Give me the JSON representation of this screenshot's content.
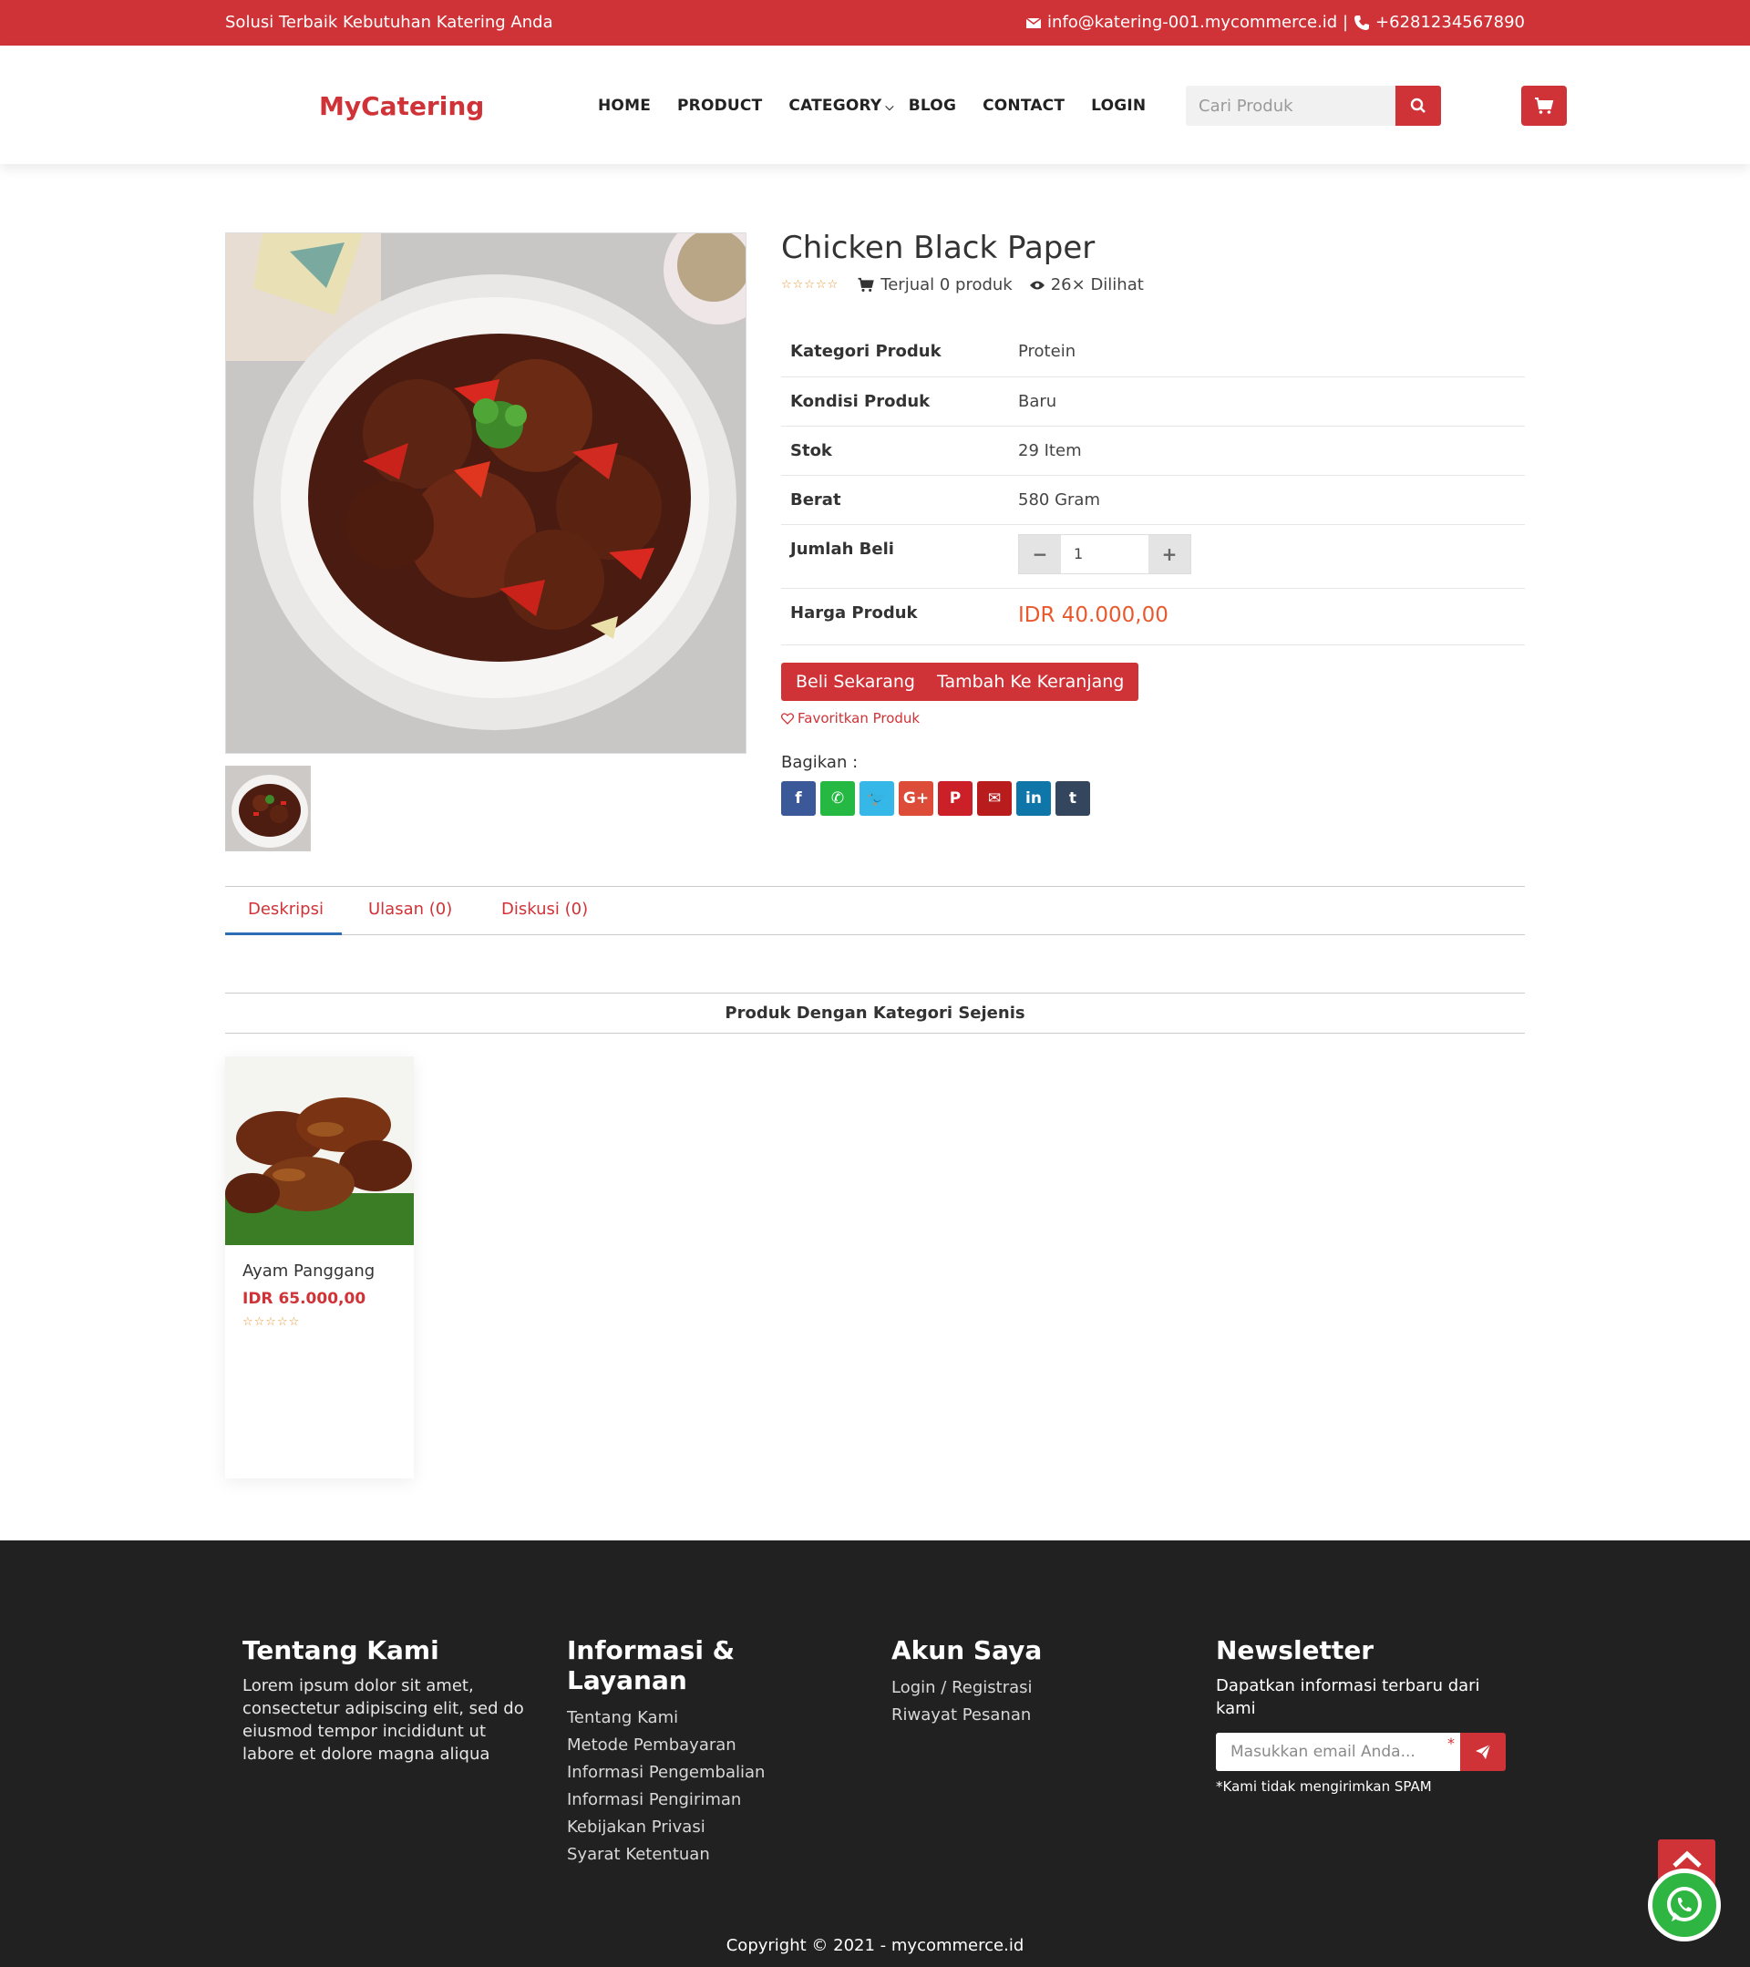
{
  "topbar": {
    "tagline": "Solusi Terbaik Kebutuhan Katering Anda",
    "contact": "info@katering-001.mycommerce.id | ",
    "phone": "+6281234567890"
  },
  "header": {
    "logo": "MyCatering",
    "nav": [
      {
        "label": "HOME"
      },
      {
        "label": "PRODUCT"
      },
      {
        "label": "CATEGORY"
      },
      {
        "label": "BLOG"
      },
      {
        "label": "CONTACT"
      },
      {
        "label": "LOGIN"
      }
    ],
    "search_placeholder": "Cari Produk"
  },
  "product": {
    "title": "Chicken Black Paper",
    "sold": "Terjual 0 produk",
    "views": "26× Dilihat",
    "specs": [
      {
        "key": "Kategori Produk",
        "value": "Protein"
      },
      {
        "key": "Kondisi Produk",
        "value": "Baru"
      },
      {
        "key": "Stok",
        "value": "29 Item"
      },
      {
        "key": "Berat",
        "value": "580 Gram"
      },
      {
        "key": "Jumlah Beli",
        "value": "1"
      },
      {
        "key": "Harga Produk",
        "value": "IDR 40.000,00"
      }
    ],
    "buy_label": "Beli Sekarang",
    "cart_label": "Tambah Ke Keranjang",
    "favorite_label": "Favoritkan Produk",
    "share_label": "Bagikan :",
    "share_buttons": [
      {
        "icon": "facebook-icon",
        "glyph": "f",
        "color": "#3b5998"
      },
      {
        "icon": "whatsapp-icon",
        "glyph": "✆",
        "color": "#25b843"
      },
      {
        "icon": "twitter-icon",
        "glyph": "🐦",
        "color": "#35b8e8"
      },
      {
        "icon": "google-plus-icon",
        "glyph": "G+",
        "color": "#dd4b39"
      },
      {
        "icon": "pinterest-icon",
        "glyph": "P",
        "color": "#cb2027"
      },
      {
        "icon": "email-icon",
        "glyph": "✉",
        "color": "#b81c1c"
      },
      {
        "icon": "linkedin-icon",
        "glyph": "in",
        "color": "#0e76a8"
      },
      {
        "icon": "tumblr-icon",
        "glyph": "t",
        "color": "#34465d"
      }
    ]
  },
  "tabs": [
    {
      "label": "Deskripsi"
    },
    {
      "label": "Ulasan (0)"
    },
    {
      "label": "Diskusi (0)"
    }
  ],
  "related": {
    "title": "Produk Dengan Kategori Sejenis",
    "items": [
      {
        "name": "Ayam Panggang",
        "price": "IDR 65.000,00"
      }
    ]
  },
  "footer": {
    "about_title": "Tentang Kami",
    "about_text": "Lorem ipsum dolor sit amet, consectetur adipiscing elit, sed do eiusmod tempor incididunt ut labore et dolore magna aliqua",
    "info_title": "Informasi & Layanan",
    "info_links": [
      "Tentang Kami",
      "Metode Pembayaran",
      "Informasi Pengembalian",
      "Informasi Pengiriman",
      "Kebijakan Privasi",
      "Syarat Ketentuan"
    ],
    "account_title": "Akun Saya",
    "account_links": [
      "Login / Registrasi",
      "Riwayat Pesanan"
    ],
    "newsletter_title": "Newsletter",
    "newsletter_text": "Dapatkan informasi terbaru dari kami",
    "newsletter_placeholder": "Masukkan email Anda...",
    "newsletter_note": "*Kami tidak mengirimkan SPAM",
    "copyright": "Copyright © 2021 - mycommerce.id"
  },
  "colors": {
    "brand": "#d03337",
    "price": "#e85a2e",
    "footer_bg": "#212121"
  }
}
